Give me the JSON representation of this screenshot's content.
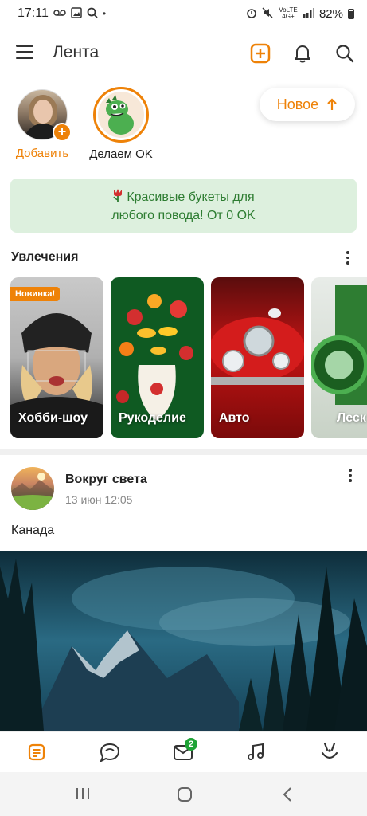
{
  "status_bar": {
    "time": "17:11",
    "left_icons": [
      "voicemail-icon",
      "image-icon",
      "search-icon",
      "dot-icon"
    ],
    "network": "VoLTE 4G+",
    "battery": "82%"
  },
  "header": {
    "title": "Лента",
    "icons": [
      "menu-icon",
      "add-icon",
      "bell-icon",
      "search-icon"
    ],
    "accent_color": "#ee8208"
  },
  "stories": [
    {
      "label": "Добавить"
    },
    {
      "label": "Делаем OK"
    }
  ],
  "new_button": {
    "label": "Новое"
  },
  "promo": {
    "line1": "Красивые букеты для",
    "line2": "любого повода! От 0 OK",
    "icon": "tulip-icon",
    "bg_color": "#ddf0de",
    "text_color": "#2e7d32"
  },
  "hobbies": {
    "title": "Увлечения",
    "cards": [
      {
        "label": "Хобби-шоу",
        "badge": "Новинка!"
      },
      {
        "label": "Рукоделие"
      },
      {
        "label": "Авто"
      },
      {
        "label": "Леск"
      }
    ]
  },
  "post": {
    "author": "Вокруг света",
    "time": "13 июн 12:05",
    "text": "Канада"
  },
  "bottom_nav": {
    "items": [
      "feed-icon",
      "chat-icon",
      "messages-icon",
      "music-icon",
      "ok-icon"
    ],
    "messages_badge": "2"
  },
  "system_nav": [
    "recent-apps-icon",
    "home-icon",
    "back-icon"
  ]
}
